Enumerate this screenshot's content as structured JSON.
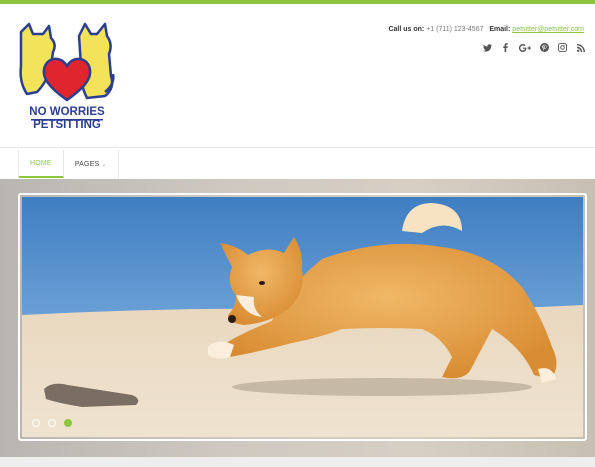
{
  "brand": {
    "logo_line1": "NO WORRIES",
    "logo_line2": "PETSITTING",
    "accent": "#8dc63f",
    "logo_blue": "#2b3e91",
    "logo_yellow": "#f3e35b",
    "logo_red": "#e0262c"
  },
  "contact": {
    "call_label": "Call us on:",
    "phone": "+1 (711) 123-4567",
    "email_label": "Email:",
    "email": "petsitter@petsitter.com"
  },
  "social": [
    "twitter-icon",
    "facebook-icon",
    "google-plus-icon",
    "pinterest-icon",
    "instagram-icon",
    "rss-icon"
  ],
  "nav": {
    "items": [
      {
        "label": "HOME",
        "active": true
      },
      {
        "label": "PAGES",
        "has_dropdown": true
      }
    ]
  },
  "slider": {
    "slides": 3,
    "active_index": 2
  }
}
